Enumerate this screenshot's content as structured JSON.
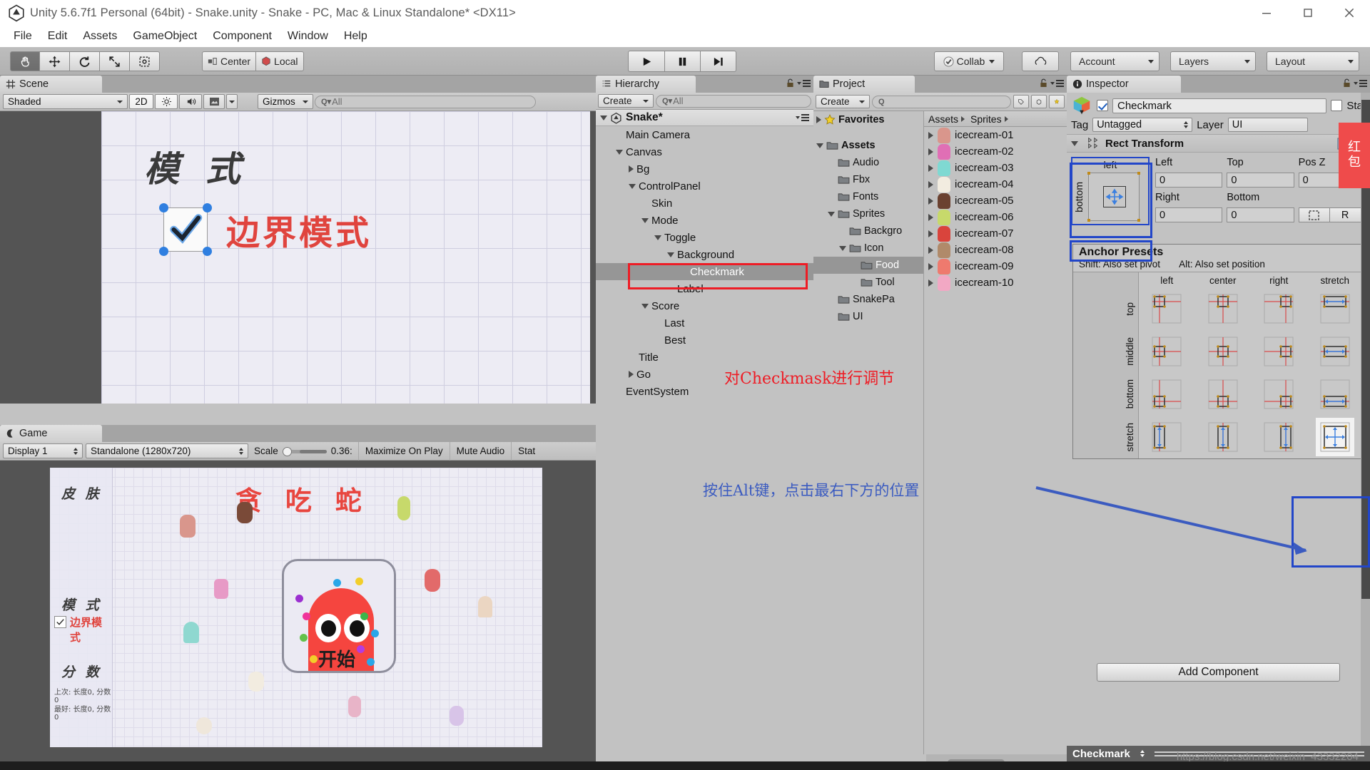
{
  "window": {
    "title": "Unity 5.6.7f1 Personal (64bit) - Snake.unity - Snake - PC, Mac & Linux Standalone* <DX11>",
    "minimize": "minimize-icon",
    "maximize": "maximize-icon",
    "close": "close-icon"
  },
  "menubar": {
    "items": [
      "File",
      "Edit",
      "Assets",
      "GameObject",
      "Component",
      "Window",
      "Help"
    ]
  },
  "toolbar": {
    "transform_tools": [
      "hand-tool",
      "move-tool",
      "rotate-tool",
      "scale-tool",
      "rect-tool"
    ],
    "pivot_mode": "Center",
    "pivot_rotation": "Local",
    "play": "play-icon",
    "pause": "pause-icon",
    "step": "step-icon",
    "collab": "Collab",
    "cloud": "cloud-icon",
    "account": "Account",
    "layers": "Layers",
    "layout": "Layout"
  },
  "scene": {
    "tab": "Scene",
    "shading": "Shaded",
    "mode2d": "2D",
    "lighting": "lighting-icon",
    "audio": "audio-icon",
    "fx": "fx-icon",
    "gizmos": "Gizmos",
    "search_placeholder": "All",
    "objects": {
      "mode_label": "模 式",
      "border_mode": "边界模式"
    }
  },
  "game": {
    "tab": "Game",
    "display": "Display 1",
    "resolution": "Standalone (1280x720)",
    "scale_label": "Scale",
    "scale_value": "0.36:",
    "maximize_on_play": "Maximize On Play",
    "mute_audio": "Mute Audio",
    "stats": "Stat",
    "content": {
      "title": "贪 吃 蛇",
      "start_button": "开始",
      "skin_label": "皮 肤",
      "mode_label": "模 式",
      "border_mode": "边界模式",
      "score_label": "分 数",
      "score_line1": "上次: 长度0, 分数0",
      "score_line2": "最好: 长度0, 分数0"
    }
  },
  "hierarchy": {
    "tab": "Hierarchy",
    "create": "Create",
    "search_placeholder": "All",
    "root": "Snake*",
    "items": [
      {
        "label": "Main Camera",
        "depth": 1,
        "arrow": "none"
      },
      {
        "label": "Canvas",
        "depth": 1,
        "arrow": "down"
      },
      {
        "label": "Bg",
        "depth": 2,
        "arrow": "right"
      },
      {
        "label": "ControlPanel",
        "depth": 2,
        "arrow": "down"
      },
      {
        "label": "Skin",
        "depth": 3,
        "arrow": "none"
      },
      {
        "label": "Mode",
        "depth": 3,
        "arrow": "down"
      },
      {
        "label": "Toggle",
        "depth": 4,
        "arrow": "down"
      },
      {
        "label": "Background",
        "depth": 5,
        "arrow": "down"
      },
      {
        "label": "Checkmark",
        "depth": 6,
        "arrow": "none",
        "selected": true
      },
      {
        "label": "Label",
        "depth": 5,
        "arrow": "none"
      },
      {
        "label": "Score",
        "depth": 3,
        "arrow": "down"
      },
      {
        "label": "Last",
        "depth": 4,
        "arrow": "none"
      },
      {
        "label": "Best",
        "depth": 4,
        "arrow": "none"
      },
      {
        "label": "Title",
        "depth": 2,
        "arrow": "none"
      },
      {
        "label": "Go",
        "depth": 2,
        "arrow": "right"
      },
      {
        "label": "EventSystem",
        "depth": 1,
        "arrow": "none"
      }
    ]
  },
  "project": {
    "tab": "Project",
    "create": "Create",
    "search_placeholder": "",
    "favorites": "Favorites",
    "tree": [
      {
        "label": "Assets",
        "depth": 0,
        "arrow": "down",
        "bold": true
      },
      {
        "label": "Audio",
        "depth": 1,
        "arrow": "none"
      },
      {
        "label": "Fbx",
        "depth": 1,
        "arrow": "none"
      },
      {
        "label": "Fonts",
        "depth": 1,
        "arrow": "none"
      },
      {
        "label": "Sprites",
        "depth": 1,
        "arrow": "down"
      },
      {
        "label": "Backgro",
        "depth": 2,
        "arrow": "none"
      },
      {
        "label": "Icon",
        "depth": 2,
        "arrow": "down"
      },
      {
        "label": "Food",
        "depth": 3,
        "arrow": "none",
        "selected": true
      },
      {
        "label": "Tool",
        "depth": 3,
        "arrow": "none"
      },
      {
        "label": "SnakePa",
        "depth": 1,
        "arrow": "none"
      },
      {
        "label": "UI",
        "depth": 1,
        "arrow": "none"
      }
    ],
    "breadcrumb": [
      "Assets",
      "Sprites"
    ],
    "assets": [
      {
        "label": "icecream-01",
        "color": "#d9968c"
      },
      {
        "label": "icecream-02",
        "color": "#e06fb5"
      },
      {
        "label": "icecream-03",
        "color": "#7fd9d2"
      },
      {
        "label": "icecream-04",
        "color": "#f2ece0"
      },
      {
        "label": "icecream-05",
        "color": "#6b4130"
      },
      {
        "label": "icecream-06",
        "color": "#c7d96b"
      },
      {
        "label": "icecream-07",
        "color": "#d9443c"
      },
      {
        "label": "icecream-08",
        "color": "#b08a6a"
      },
      {
        "label": "icecream-09",
        "color": "#ee7a6e"
      },
      {
        "label": "icecream-10",
        "color": "#f2a8c4"
      }
    ]
  },
  "inspector": {
    "tab": "Inspector",
    "object_enabled": true,
    "object_name": "Checkmark",
    "static_label": "Stat",
    "tag_label": "Tag",
    "tag_value": "Untagged",
    "layer_label": "Layer",
    "layer_value": "UI",
    "component_title": "Rect Transform",
    "anchor_preset_label_x": "left",
    "anchor_preset_label_y": "bottom",
    "fields": [
      {
        "label": "Left",
        "value": "0"
      },
      {
        "label": "Top",
        "value": "0"
      },
      {
        "label": "Pos Z",
        "value": "0"
      },
      {
        "label": "Right",
        "value": "0"
      },
      {
        "label": "Bottom",
        "value": "0"
      }
    ],
    "blueprint_button": "blueprint-icon",
    "raw_button": "R",
    "anchor_presets": {
      "title": "Anchor Presets",
      "hint_shift": "Shift: Also set pivot",
      "hint_alt": "Alt: Also set position",
      "columns": [
        "left",
        "center",
        "right",
        "stretch"
      ],
      "rows": [
        "top",
        "middle",
        "bottom",
        "stretch"
      ],
      "selected_row": "stretch",
      "selected_col": "stretch"
    },
    "add_component": "Add Component",
    "footer_name": "Checkmark"
  },
  "annotations": {
    "hierarchy_note": "对Checkmask进行调节",
    "anchor_note": "按住Alt键，点击最右下方的位置",
    "hongbao": "红包"
  },
  "watermark": "https://blog.csdn.net/weixin_43332204",
  "colors": {
    "accent_red": "#ee1c25",
    "accent_blue": "#2246c9",
    "selection_gray": "#969696",
    "panel_bg": "#c2c2c2"
  }
}
